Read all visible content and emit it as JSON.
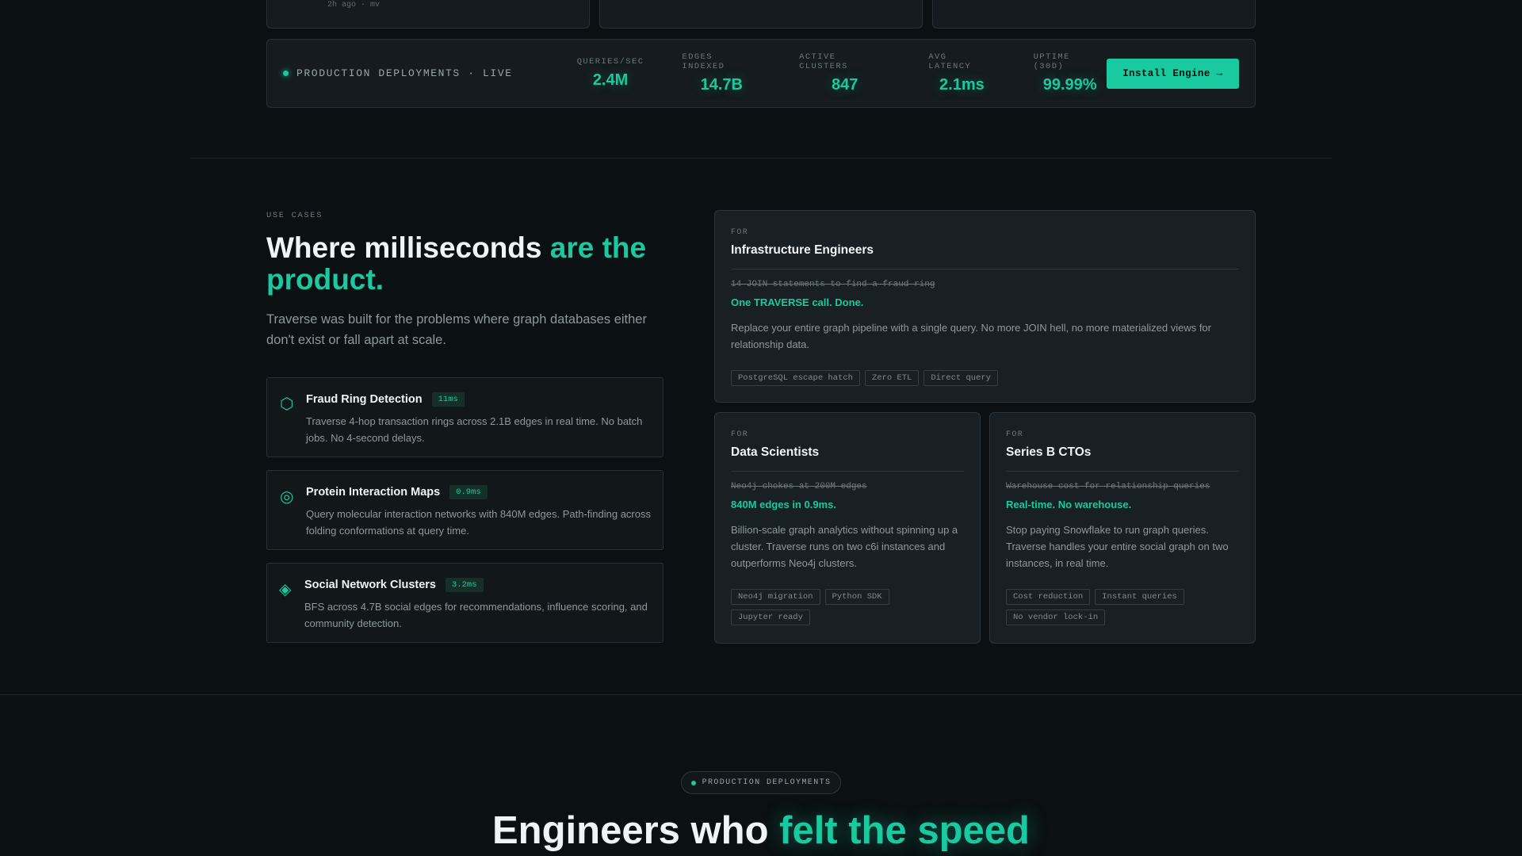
{
  "top_cards": [
    {
      "meta": "2h ago · mv"
    },
    {
      "meta": ""
    },
    {
      "meta": ""
    }
  ],
  "stats_bar": {
    "live_label": "PRODUCTION DEPLOYMENTS · LIVE",
    "stats": [
      {
        "label": "QUERIES/SEC",
        "value": "2.4M"
      },
      {
        "label": "EDGES INDEXED",
        "value": "14.7B"
      },
      {
        "label": "ACTIVE CLUSTERS",
        "value": "847"
      },
      {
        "label": "AVG LATENCY",
        "value": "2.1ms"
      },
      {
        "label": "UPTIME (30D)",
        "value": "99.99%"
      }
    ],
    "install_label": "Install Engine →"
  },
  "use_cases": {
    "eyebrow": "USE CASES",
    "title_plain": "Where milliseconds ",
    "title_accent": "are the product.",
    "subtitle": "Traverse was built for the problems where graph databases either don't exist or fall apart at scale.",
    "items": [
      {
        "icon": "hexagon-icon",
        "glyph": "⬡",
        "name": "Fraud Ring Detection",
        "badge": "11ms",
        "desc": "Traverse 4-hop transaction rings across 2.1B edges in real time. No batch jobs. No 4-second delays."
      },
      {
        "icon": "target-icon",
        "glyph": "◎",
        "name": "Protein Interaction Maps",
        "badge": "0.9ms",
        "desc": "Query molecular interaction networks with 840M edges. Path-finding across folding conformations at query time."
      },
      {
        "icon": "diamond-icon",
        "glyph": "◈",
        "name": "Social Network Clusters",
        "badge": "3.2ms",
        "desc": "BFS across 4.7B social edges for recommendations, influence scoring, and community detection."
      }
    ]
  },
  "personas": [
    {
      "for": "FOR",
      "who": "Infrastructure Engineers",
      "old": "14 JOIN statements to find a fraud ring",
      "new": "One TRAVERSE call. Done.",
      "body": "Replace your entire graph pipeline with a single query. No more JOIN hell, no more materialized views for relationship data.",
      "tags": [
        "PostgreSQL escape hatch",
        "Zero ETL",
        "Direct query"
      ]
    },
    {
      "for": "FOR",
      "who": "Data Scientists",
      "old": "Neo4j chokes at 200M edges",
      "new": "840M edges in 0.9ms.",
      "body": "Billion-scale graph analytics without spinning up a cluster. Traverse runs on two c6i instances and outperforms Neo4j clusters.",
      "tags": [
        "Neo4j migration",
        "Python SDK",
        "Jupyter ready"
      ]
    },
    {
      "for": "FOR",
      "who": "Series B CTOs",
      "old": "Warehouse cost for relationship queries",
      "new": "Real-time. No warehouse.",
      "body": "Stop paying Snowflake to run graph queries. Traverse handles your entire social graph on two instances, in real time.",
      "tags": [
        "Cost reduction",
        "Instant queries",
        "No vendor lock-in"
      ]
    }
  ],
  "testimonials": {
    "pill_label": "PRODUCTION DEPLOYMENTS",
    "headline_plain": "Engineers who ",
    "headline_accent": "felt the speed"
  },
  "colors": {
    "accent": "#19c9a0",
    "background": "#0b1012",
    "card": "#192023"
  }
}
